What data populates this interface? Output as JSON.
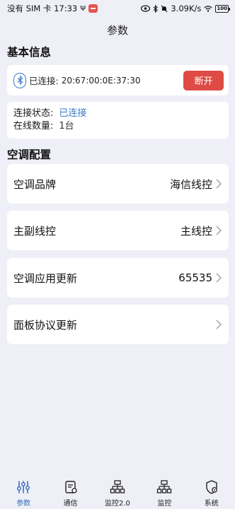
{
  "status_bar": {
    "left_text": "没有 SIM 卡 17:33",
    "network_speed": "3.09K/s",
    "battery": "100"
  },
  "title": "参数",
  "basic_info": {
    "heading": "基本信息",
    "connected_label": "已连接:",
    "mac": "20:67:00:0E:37:30",
    "disconnect_label": "断开",
    "conn_status_label": "连接状态:",
    "conn_status_value": "已连接",
    "online_count_label": "在线数量:",
    "online_count_value": "1台"
  },
  "ac_config": {
    "heading": "空调配置",
    "rows": [
      {
        "label": "空调品牌",
        "value": "海信线控"
      },
      {
        "label": "主副线控",
        "value": "主线控"
      },
      {
        "label": "空调应用更新",
        "value": "65535"
      },
      {
        "label": "面板协议更新",
        "value": ""
      }
    ]
  },
  "nav": {
    "items": [
      {
        "label": "参数"
      },
      {
        "label": "通信"
      },
      {
        "label": "监控2.0"
      },
      {
        "label": "监控"
      },
      {
        "label": "系统"
      }
    ],
    "active_color": "#3a6fc2"
  },
  "colors": {
    "accent": "#3c79c4",
    "danger": "#de4b44",
    "background": "#eeeff7"
  }
}
